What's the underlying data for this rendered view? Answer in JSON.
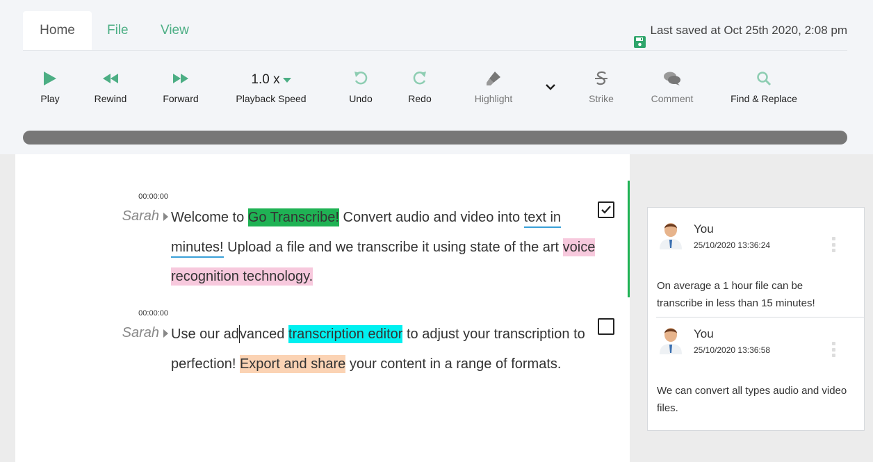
{
  "tabs": [
    {
      "label": "Home"
    },
    {
      "label": "File"
    },
    {
      "label": "View"
    }
  ],
  "saved_text": "Last saved at Oct 25th 2020, 2:08 pm",
  "toolbar": {
    "play": "Play",
    "rewind": "Rewind",
    "forward": "Forward",
    "speed_value": "1.0 x",
    "speed_label": "Playback Speed",
    "undo": "Undo",
    "redo": "Redo",
    "highlight": "Highlight",
    "strike": "Strike",
    "comment": "Comment",
    "find_replace": "Find & Replace"
  },
  "icons": {
    "save": "save-icon",
    "play": "play-icon",
    "rewind": "rewind-icon",
    "forward": "forward-icon",
    "undo": "undo-icon",
    "redo": "redo-icon",
    "highlight": "highlighter-icon",
    "more": "chevron-down-icon",
    "strike": "strikethrough-icon",
    "comment": "comment-icon",
    "find": "search-icon"
  },
  "colors": {
    "accent": "#4cae84",
    "highlight_green": "#1fb254",
    "highlight_pink": "#f7c9dd",
    "highlight_cyan": "#00f0f0",
    "highlight_peach": "#fbd3b4",
    "underline_blue": "#3aa0d8"
  },
  "segments": [
    {
      "timestamp": "00:00:00",
      "speaker": "Sarah",
      "checked": true,
      "parts": [
        "Welcome to ",
        "Go Transcribe!",
        " Convert audio and video into ",
        "text in minutes!",
        "  Upload a file and we transcribe it using state of the art ",
        "voice recognition technology."
      ]
    },
    {
      "timestamp": "00:00:00",
      "speaker": "Sarah",
      "checked": false,
      "parts": [
        "Use our ad",
        "vanced ",
        "transcription editor",
        " to adjust your transcription to perfection! ",
        "Export and share",
        " your content in a range of formats."
      ]
    }
  ],
  "comments": [
    {
      "author": "You",
      "date": "25/10/2020 13:36:24",
      "text": "On average a 1 hour file can be transcribe in less than 15 minutes!"
    },
    {
      "author": "You",
      "date": "25/10/2020 13:36:58",
      "text": "We can convert all types audio and video files."
    }
  ]
}
